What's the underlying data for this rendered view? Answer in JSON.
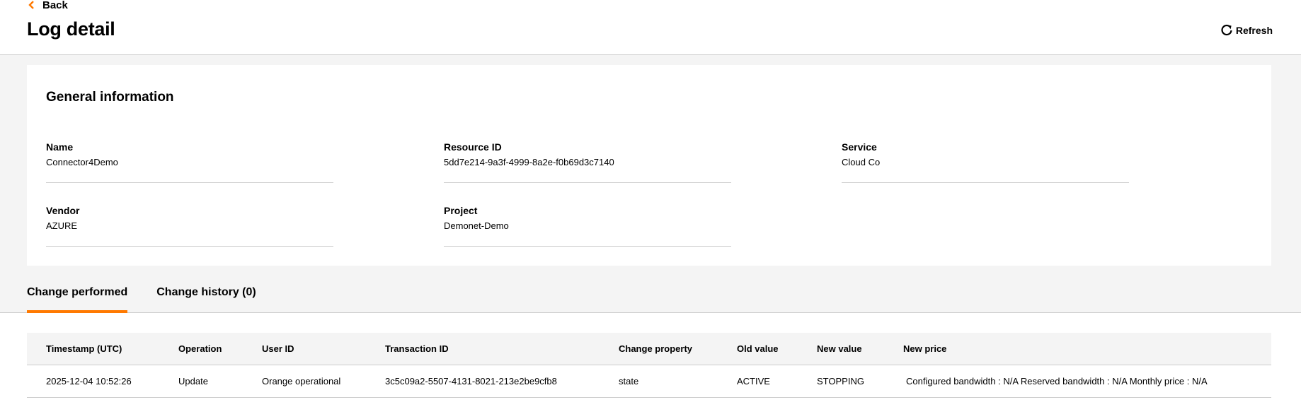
{
  "header": {
    "back_label": "Back",
    "title": "Log detail",
    "refresh_label": "Refresh"
  },
  "icons": {
    "back": "chevron-left-icon",
    "refresh": "refresh-icon"
  },
  "colors": {
    "accent": "#ff7900",
    "background_grey": "#f4f4f4",
    "divider": "#cccccc"
  },
  "general_info": {
    "title": "General information",
    "fields": [
      {
        "label": "Name",
        "value": "Connector4Demo"
      },
      {
        "label": "Resource ID",
        "value": "5dd7e214-9a3f-4999-8a2e-f0b69d3c7140"
      },
      {
        "label": "Service",
        "value": "Cloud Co"
      },
      {
        "label": "Vendor",
        "value": "AZURE"
      },
      {
        "label": "Project",
        "value": "Demonet-Demo"
      }
    ]
  },
  "tabs": [
    {
      "label": "Change performed",
      "active": true
    },
    {
      "label": "Change history (0)",
      "active": false
    }
  ],
  "table": {
    "columns": [
      "Timestamp (UTC)",
      "Operation",
      "User ID",
      "Transaction ID",
      "Change property",
      "Old value",
      "New value",
      "New price"
    ],
    "rows": [
      [
        "2025-12-04 10:52:26",
        "Update",
        "Orange operational",
        "3c5c09a2-5507-4131-8021-213e2be9cfb8",
        "state",
        "ACTIVE",
        "STOPPING",
        "Configured bandwidth : N/A Reserved bandwidth : N/A Monthly price : N/A"
      ]
    ]
  }
}
